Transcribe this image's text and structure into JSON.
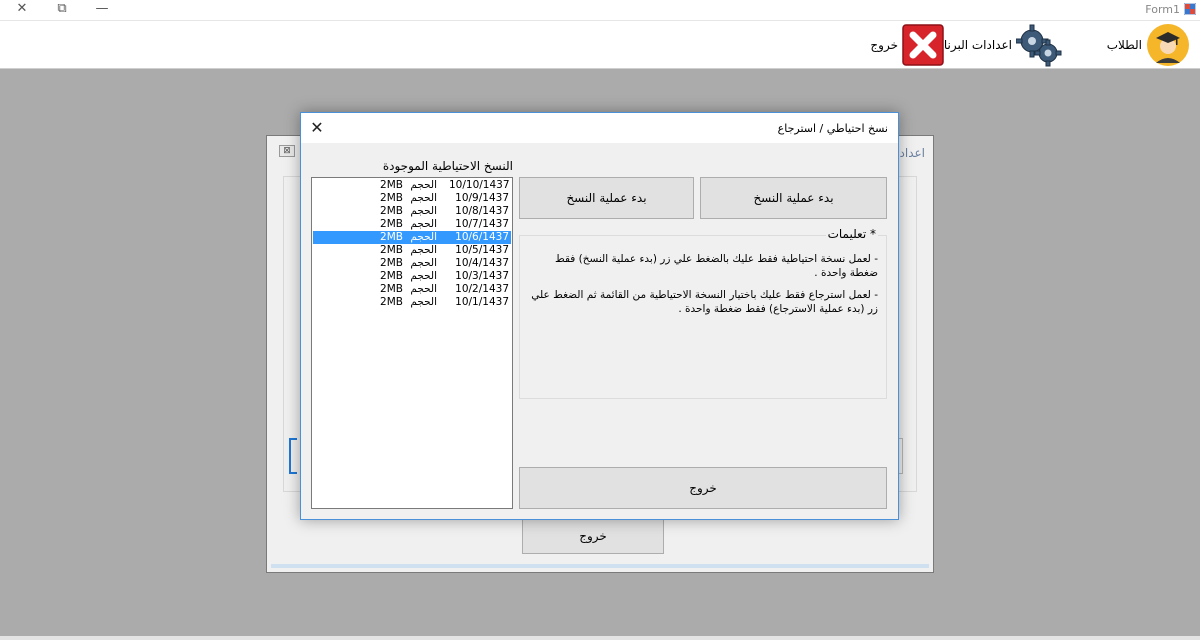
{
  "window": {
    "title": "Form1",
    "controls": {
      "close": "✕",
      "restore": "⧉",
      "minimize": "—"
    }
  },
  "toolbar": {
    "items": [
      {
        "label": "الطلاب",
        "icon": "student-avatar-icon"
      },
      {
        "label": "اعدادات البرنامج",
        "icon": "gear-icon"
      },
      {
        "label": "خروج",
        "icon": "red-x-icon"
      }
    ]
  },
  "parent_window": {
    "title": "اعداد",
    "exit_label": "خروج"
  },
  "dialog": {
    "title": "نسخ احتياطي / استرجاع",
    "close_glyph": "✕",
    "list_caption": "النسخ الاحتياطية الموجودة",
    "backups": [
      {
        "date": "10/10/1437",
        "word": "الحجم",
        "size": "2MB",
        "selected": false
      },
      {
        "date": "10/9/1437",
        "word": "الحجم",
        "size": "2MB",
        "selected": false
      },
      {
        "date": "10/8/1437",
        "word": "الحجم",
        "size": "2MB",
        "selected": false
      },
      {
        "date": "10/7/1437",
        "word": "الحجم",
        "size": "2MB",
        "selected": false
      },
      {
        "date": "10/6/1437",
        "word": "الحجم",
        "size": "2MB",
        "selected": true
      },
      {
        "date": "10/5/1437",
        "word": "الحجم",
        "size": "2MB",
        "selected": false
      },
      {
        "date": "10/4/1437",
        "word": "الحجم",
        "size": "2MB",
        "selected": false
      },
      {
        "date": "10/3/1437",
        "word": "الحجم",
        "size": "2MB",
        "selected": false
      },
      {
        "date": "10/2/1437",
        "word": "الحجم",
        "size": "2MB",
        "selected": false
      },
      {
        "date": "10/1/1437",
        "word": "الحجم",
        "size": "2MB",
        "selected": false
      }
    ],
    "backup_button": "بدء عملية النسخ",
    "restore_button": "بدء عملية النسخ",
    "instructions_title": "* تعليمات",
    "instructions": [
      "- لعمل نسخة احتياطية فقط عليك بالضغط علي زر (بدء عملية النسخ) فقط ضغطة واحدة .",
      "- لعمل استرجاع فقط عليك باختيار النسخة الاحتياطية من القائمة ثم الضغط علي زر (بدء عملية الاسترجاع) فقط ضغطة واحدة ."
    ],
    "exit_button": "خروج"
  },
  "colors": {
    "selection": "#3399ff",
    "dialog_border": "#4a90d9",
    "background": "#ababab"
  }
}
